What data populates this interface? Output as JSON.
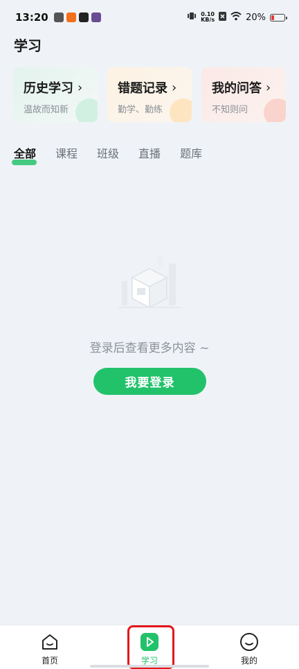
{
  "status_bar": {
    "time": "13:20",
    "net_speed_value": "0.10",
    "net_speed_unit": "KB/s",
    "battery_percent": "20%",
    "battery_level": 0.2
  },
  "page": {
    "title": "学习"
  },
  "cards": [
    {
      "title": "历史学习",
      "subtitle": "温故而知新"
    },
    {
      "title": "错题记录",
      "subtitle": "勤学、勤练"
    },
    {
      "title": "我的问答",
      "subtitle": "不知则问"
    }
  ],
  "tabs": [
    "全部",
    "课程",
    "班级",
    "直播",
    "题库"
  ],
  "empty_state": {
    "message": "登录后查看更多内容 ~",
    "login_button": "我要登录"
  },
  "bottom_nav": [
    {
      "label": "首页",
      "icon": "home-icon"
    },
    {
      "label": "学习",
      "icon": "play-icon",
      "active": true
    },
    {
      "label": "我的",
      "icon": "profile-icon"
    }
  ],
  "colors": {
    "accent": "#22c26b",
    "highlight": "#e3161b"
  }
}
